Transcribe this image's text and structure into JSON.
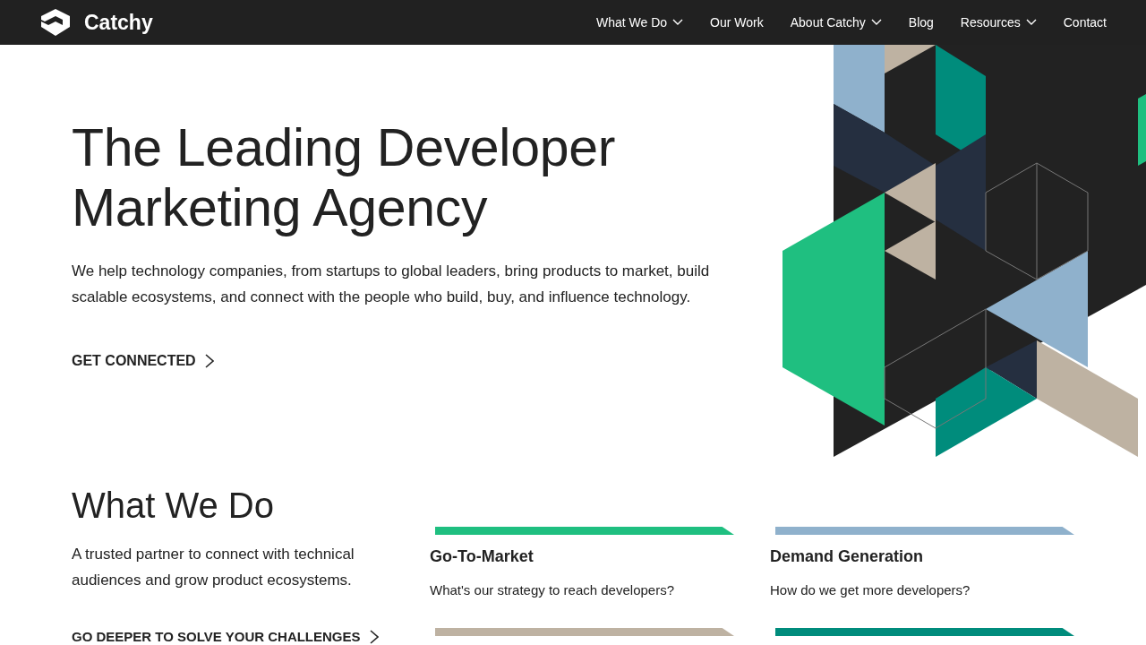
{
  "header": {
    "brand": "Catchy",
    "nav": [
      {
        "label": "What We Do",
        "dropdown": true
      },
      {
        "label": "Our Work",
        "dropdown": false
      },
      {
        "label": "About Catchy",
        "dropdown": true
      },
      {
        "label": "Blog",
        "dropdown": false
      },
      {
        "label": "Resources",
        "dropdown": true
      },
      {
        "label": "Contact",
        "dropdown": false
      }
    ]
  },
  "hero": {
    "title_lines": [
      "The Leading Developer",
      "Marketing Agency"
    ],
    "text": "We help technology companies, from startups to global leaders, bring products to market, build scalable ecosystems, and connect with the people who build, buy, and influence technology.",
    "cta": "GET CONNECTED"
  },
  "what_we_do": {
    "heading": "What We Do",
    "text": "A trusted partner to connect with technical audiences and grow product ecosystems.",
    "cta": "GO DEEPER TO SOLVE YOUR CHALLENGES",
    "cards": [
      {
        "color": "#1fbf80",
        "title": "Go-To-Market",
        "text": "What's our strategy to reach developers?"
      },
      {
        "color": "#8fb1cc",
        "title": "Demand Generation",
        "text": "How do we get more developers?"
      },
      {
        "color": "#beb2a2"
      },
      {
        "color": "#008c7c"
      }
    ]
  }
}
